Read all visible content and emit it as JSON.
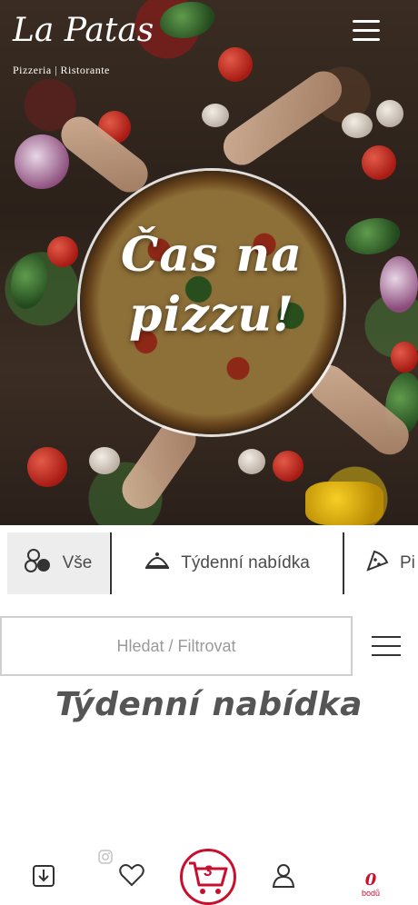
{
  "brand": {
    "name": "La Patas",
    "tagline": "Pizzeria | Ristorante"
  },
  "hero": {
    "slogan_line1": "Čas na",
    "slogan_line2": "pizzu!"
  },
  "categories": [
    {
      "label": "Vše",
      "icon": "circles-icon"
    },
    {
      "label": "Týdenní nabídka",
      "icon": "cloche-icon"
    },
    {
      "label": "Pi",
      "icon": "pizza-slice-icon"
    }
  ],
  "search": {
    "placeholder": "Hledat / Filtrovat"
  },
  "section": {
    "title": "Týdenní nabídka"
  },
  "bottom_nav": {
    "cart_count": "3",
    "points_value": "0",
    "points_label": "bodů"
  },
  "colors": {
    "accent": "#c8102e"
  }
}
